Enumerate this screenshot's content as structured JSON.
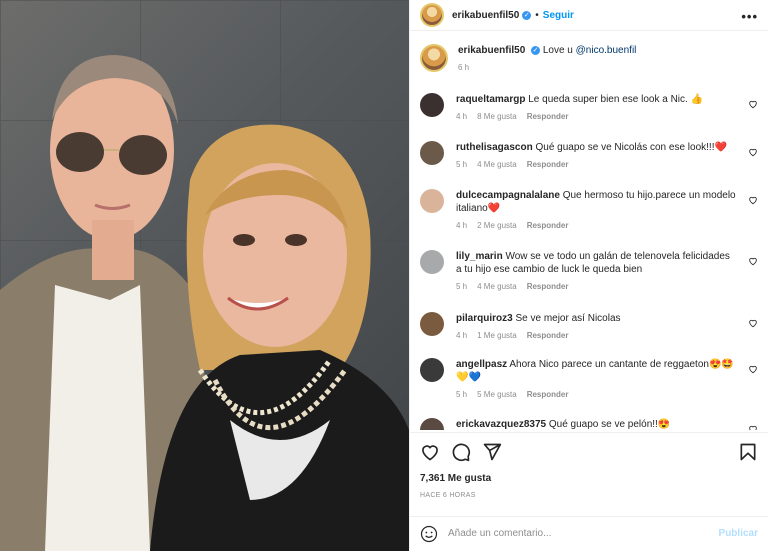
{
  "post": {
    "author": "erikabuenfil50",
    "follow_label": "Seguir",
    "more_label": "•••",
    "dot": "•"
  },
  "caption": {
    "author": "erikabuenfil50",
    "text_before": " Love u ",
    "mention": "@nico.buenfil",
    "time": "6 h"
  },
  "comments": [
    {
      "user": "raqueltamargp",
      "text": " Le queda super bien ese look a Nic. 👍",
      "time": "4 h",
      "likes": "8 Me gusta",
      "reply": "Responder",
      "avatar_color": "#3b3030"
    },
    {
      "user": "ruthelisagascon",
      "text": " Qué guapo se ve Nicolás con ese look!!!❤️",
      "time": "5 h",
      "likes": "4 Me gusta",
      "reply": "Responder",
      "avatar_color": "#6b5a49"
    },
    {
      "user": "dulcecampagnalalane",
      "text": " Que hermoso tu hijo.parece un modelo italiano❤️",
      "time": "4 h",
      "likes": "2 Me gusta",
      "reply": "Responder",
      "avatar_color": "#d9b49b"
    },
    {
      "user": "lily_marin",
      "text": " Wow se ve todo un galán de telenovela felicidades a tu hijo ese cambio de luck le queda bien",
      "time": "5 h",
      "likes": "4 Me gusta",
      "reply": "Responder",
      "avatar_color": "#a7a9ab"
    },
    {
      "user": "pilarquiroz3",
      "text": " Se ve mejor así Nicolas",
      "time": "4 h",
      "likes": "1 Me gusta",
      "reply": "Responder",
      "avatar_color": "#7a5b40"
    },
    {
      "user": "angellpasz",
      "text": " Ahora Nico parece un cantante de reggaeton😍🤩💛💙",
      "time": "5 h",
      "likes": "5 Me gusta",
      "reply": "Responder",
      "avatar_color": "#3a3a3a"
    },
    {
      "user": "erickavazquez8375",
      "text": " Qué guapo se ve pelón!!😍",
      "time": "",
      "likes": "",
      "reply": "",
      "avatar_color": "#5a4a42"
    }
  ],
  "actions": {
    "likes": "7,361 Me gusta",
    "ago": "Hace 6 horas",
    "add_placeholder": "Añade un comentario...",
    "post_label": "Publicar"
  },
  "icons": [
    "heart-icon",
    "comment-icon",
    "share-icon",
    "save-icon",
    "emoji-icon"
  ]
}
